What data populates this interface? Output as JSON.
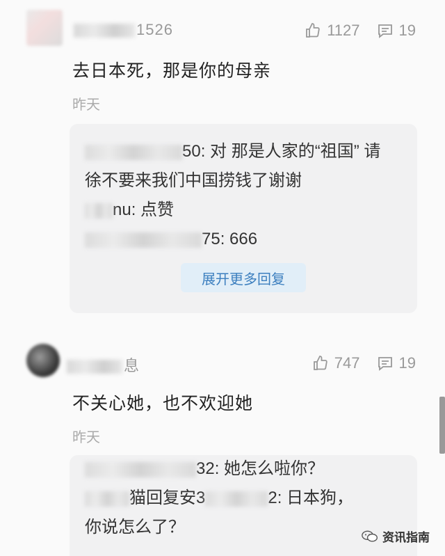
{
  "comments": [
    {
      "username_visible": "1526",
      "likes": "1127",
      "replies_count": "19",
      "text": "去日本死，那是你的母亲",
      "time": "昨天",
      "replies": [
        {
          "user_visible": "50:",
          "text": "对 那是人家的“祖国” 请"
        },
        {
          "user_visible": "",
          "text": "徐不要来我们中国捞钱了谢谢"
        },
        {
          "user_visible": "nu:",
          "text": "点赞"
        },
        {
          "user_visible": "75:",
          "text": "666"
        }
      ],
      "expand_label": "展开更多回复"
    },
    {
      "username_visible": "息",
      "likes": "747",
      "replies_count": "19",
      "text": "不关心她，也不欢迎她",
      "time": "昨天",
      "replies": [
        {
          "user_visible": "32:",
          "text": "她怎么啦你？"
        },
        {
          "user_visible": "猫回复安3",
          "user_visible2": "2:",
          "text": "日本狗，"
        },
        {
          "user_visible": "",
          "text": "你说怎么了？"
        }
      ]
    }
  ],
  "watermark": {
    "text": "资讯指南",
    "icon": "wechat-icon"
  },
  "colors": {
    "link_blue": "#3c7fbf",
    "expand_bg": "#e1eef8",
    "muted": "#999999"
  }
}
